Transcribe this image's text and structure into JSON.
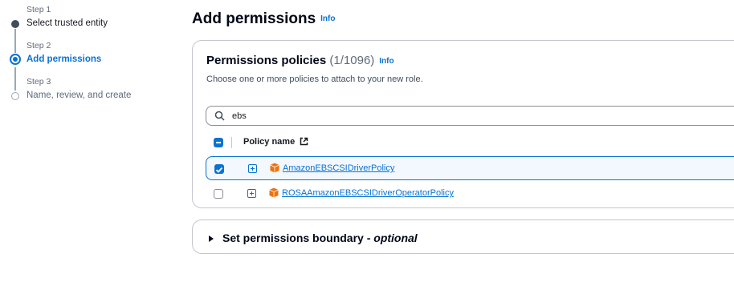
{
  "steps": [
    {
      "num": "Step 1",
      "title": "Select trusted entity"
    },
    {
      "num": "Step 2",
      "title": "Add permissions"
    },
    {
      "num": "Step 3",
      "title": "Name, review, and create"
    }
  ],
  "page": {
    "title": "Add permissions",
    "info": "Info"
  },
  "policies": {
    "title": "Permissions policies",
    "count": "(1/1096)",
    "info": "Info",
    "description": "Choose one or more policies to attach to your new role.",
    "search_value": "ebs",
    "column_header": "Policy name",
    "rows": [
      {
        "name": "AmazonEBSCSIDriverPolicy",
        "checked": true
      },
      {
        "name": "ROSAAmazonEBSCSIDriverOperatorPolicy",
        "checked": false
      }
    ]
  },
  "boundary": {
    "title": "Set permissions boundary - ",
    "optional": "optional"
  },
  "colors": {
    "accent": "#0972d3",
    "border": "#c6c6cd",
    "icon_orange": "#ec7211"
  },
  "icons": [
    "search-icon",
    "external-link-icon",
    "expand-icon",
    "aws-policy-cube-icon",
    "caret-right-icon"
  ]
}
